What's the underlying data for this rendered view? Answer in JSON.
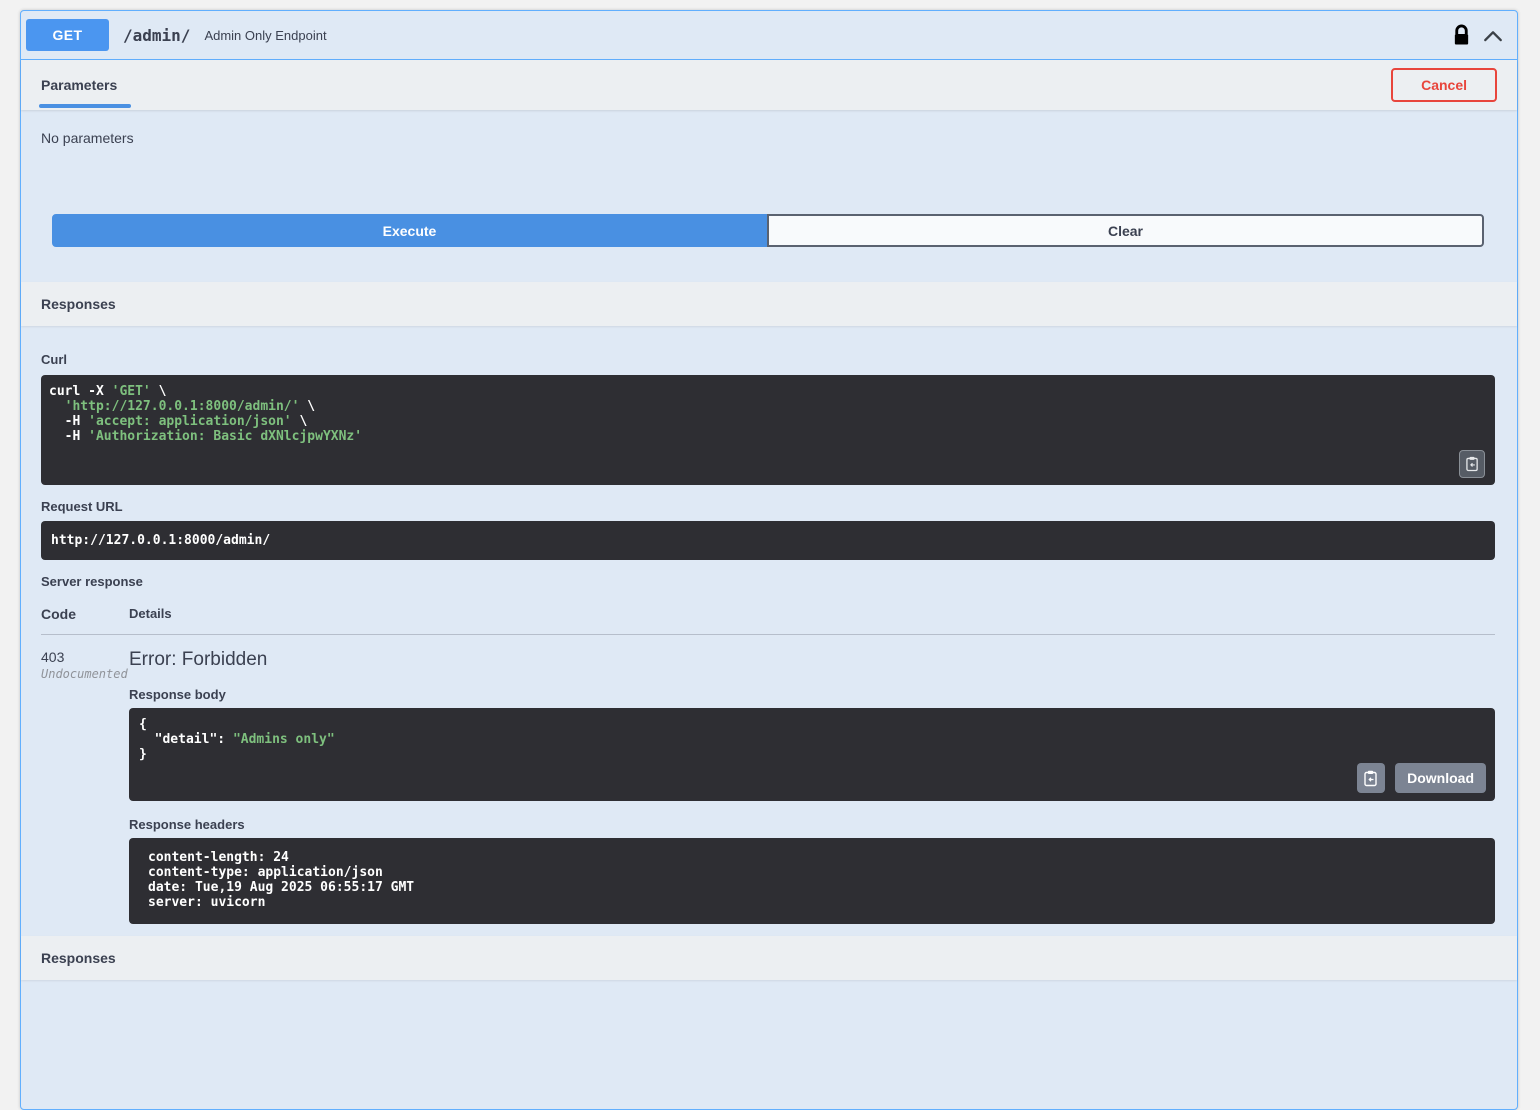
{
  "operation": {
    "method": "GET",
    "path": "/admin/",
    "summary": "Admin Only Endpoint"
  },
  "icons": {
    "auth": "lock-closed",
    "collapse": "chevron-up",
    "copy": "clipboard-copy"
  },
  "parameters_section": {
    "tab_label": "Parameters",
    "cancel_button": "Cancel",
    "empty_text": "No parameters",
    "execute_button": "Execute",
    "clear_button": "Clear"
  },
  "responses_section": {
    "header": "Responses",
    "curl": {
      "label": "Curl",
      "line1_cmd": "curl -X ",
      "line1_str": "'GET'",
      "line1_end": " \\",
      "line2_pre": "  ",
      "line2_str": "'http://127.0.0.1:8000/admin/'",
      "line2_end": " \\",
      "line3_pre": "  -H ",
      "line3_str": "'accept: application/json'",
      "line3_end": " \\",
      "line4_pre": "  -H ",
      "line4_str": "'Authorization: Basic dXNlcjpwYXNz'"
    },
    "request_url": {
      "label": "Request URL",
      "value": "http://127.0.0.1:8000/admin/"
    },
    "server_response": {
      "label": "Server response",
      "code_header": "Code",
      "details_header": "Details",
      "code": "403",
      "code_note": "Undocumented",
      "description": "Error: Forbidden",
      "body": {
        "label": "Response body",
        "open_brace": "{",
        "indent": "  ",
        "key": "\"detail\"",
        "separator": ": ",
        "value": "\"Admins only\"",
        "close_brace": "}",
        "download_button": "Download"
      },
      "headers": {
        "label": "Response headers",
        "lines": [
          "content-length: 24",
          "content-type: application/json",
          "date: Tue,19 Aug 2025 06:55:17 GMT",
          "server: uvicorn"
        ]
      }
    },
    "footer_header": "Responses"
  },
  "colors": {
    "method_badge_blue": "#4b96f0",
    "block_border_blue": "#61affe",
    "block_background": "#dfe9f5",
    "section_header_bg": "#eceff2",
    "execute_blue": "#4990e2",
    "cancel_red": "#e8453c",
    "code_background": "#2e2e33",
    "code_string_green": "#7ec07e",
    "text_dark": "#3b4151",
    "gray_button": "#7c8493"
  }
}
